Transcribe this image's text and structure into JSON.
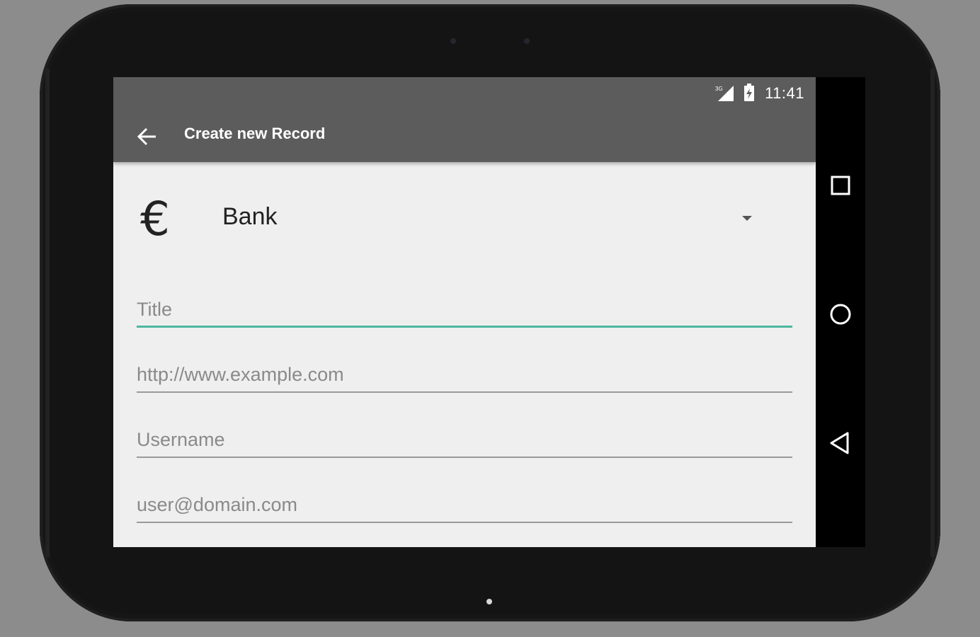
{
  "status_bar": {
    "time": "11:41",
    "signal_icon": "signal-3g-icon",
    "battery_icon": "battery-charging-icon"
  },
  "toolbar": {
    "back_icon": "arrow-back-icon",
    "title": "Create new Record"
  },
  "category": {
    "icon": "euro-icon",
    "value": "Bank",
    "dropdown_icon": "dropdown-arrow-icon"
  },
  "fields": {
    "title_placeholder": "Title",
    "url_placeholder": "http://www.example.com",
    "username_placeholder": "Username",
    "email_placeholder": "user@domain.com"
  },
  "nav_bar": {
    "recents_icon": "square-recents-icon",
    "home_icon": "circle-home-icon",
    "back_icon": "triangle-back-icon"
  },
  "colors": {
    "toolbar": "#5c5c5c",
    "accent": "#4db6a0",
    "background": "#efefef"
  }
}
